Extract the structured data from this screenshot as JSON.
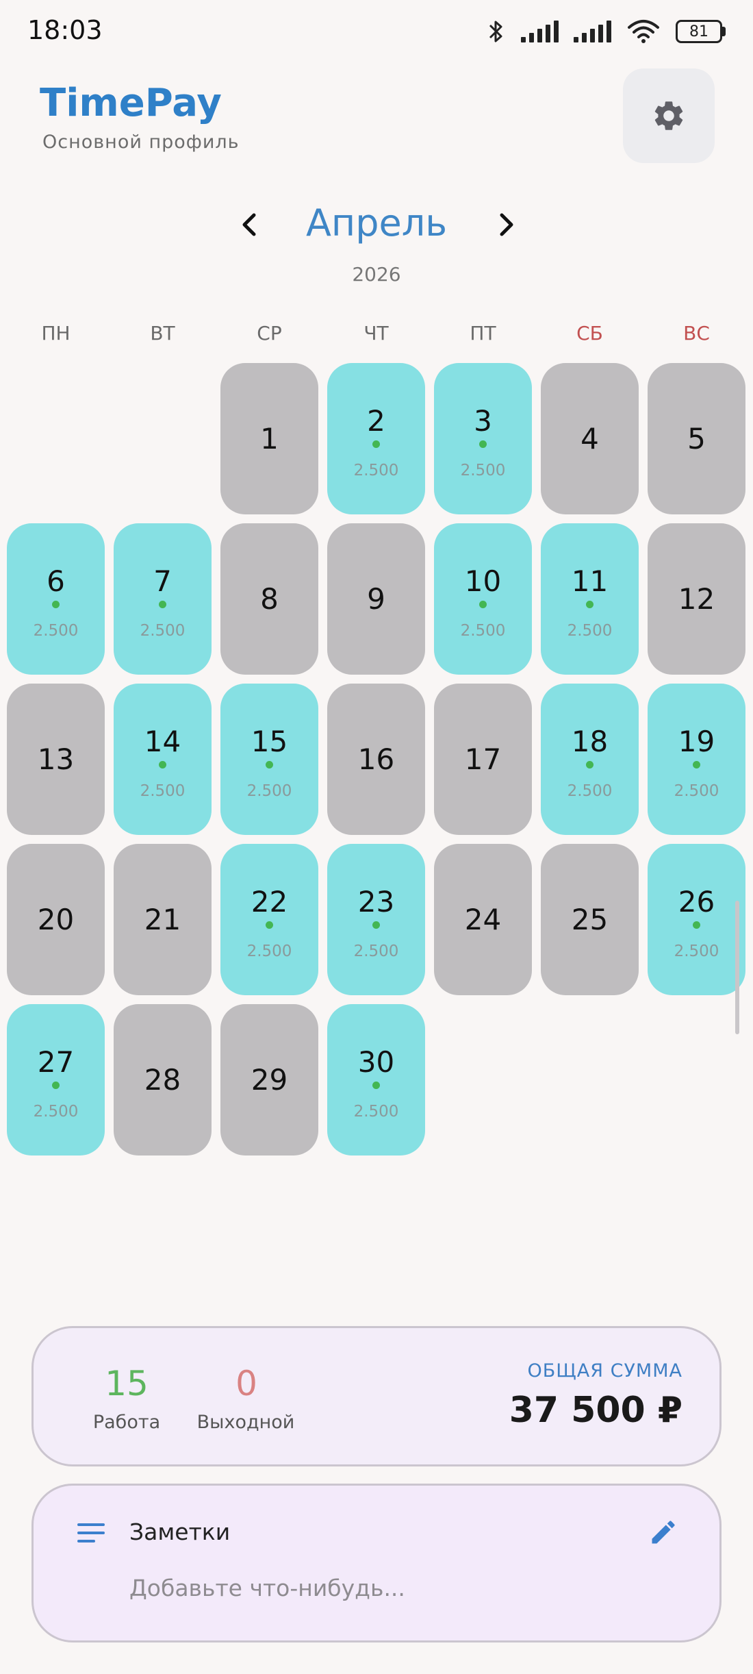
{
  "status_bar": {
    "time": "18:03",
    "battery": "81",
    "icons": [
      "bluetooth-icon",
      "signal-icon",
      "signal-icon",
      "wifi-icon",
      "battery-icon"
    ]
  },
  "header": {
    "title": "TimePay",
    "subtitle": "Основной профиль",
    "settings_icon": "gear-icon"
  },
  "calendar": {
    "month": "Апрель",
    "year": "2026",
    "prev_icon": "chevron-left-icon",
    "next_icon": "chevron-right-icon",
    "weekdays": [
      {
        "label": "ПН",
        "weekend": false
      },
      {
        "label": "ВТ",
        "weekend": false
      },
      {
        "label": "СР",
        "weekend": false
      },
      {
        "label": "ЧТ",
        "weekend": false
      },
      {
        "label": "ПТ",
        "weekend": false
      },
      {
        "label": "СБ",
        "weekend": true
      },
      {
        "label": "ВС",
        "weekend": true
      }
    ],
    "first_weekday_index": 2,
    "days": [
      {
        "day": "1",
        "status": "off"
      },
      {
        "day": "2",
        "status": "work",
        "amount": "2.500"
      },
      {
        "day": "3",
        "status": "work",
        "amount": "2.500"
      },
      {
        "day": "4",
        "status": "off"
      },
      {
        "day": "5",
        "status": "off"
      },
      {
        "day": "6",
        "status": "work",
        "amount": "2.500"
      },
      {
        "day": "7",
        "status": "work",
        "amount": "2.500"
      },
      {
        "day": "8",
        "status": "off"
      },
      {
        "day": "9",
        "status": "off"
      },
      {
        "day": "10",
        "status": "work",
        "amount": "2.500"
      },
      {
        "day": "11",
        "status": "work",
        "amount": "2.500"
      },
      {
        "day": "12",
        "status": "off"
      },
      {
        "day": "13",
        "status": "off"
      },
      {
        "day": "14",
        "status": "work",
        "amount": "2.500"
      },
      {
        "day": "15",
        "status": "work",
        "amount": "2.500"
      },
      {
        "day": "16",
        "status": "off"
      },
      {
        "day": "17",
        "status": "off"
      },
      {
        "day": "18",
        "status": "work",
        "amount": "2.500"
      },
      {
        "day": "19",
        "status": "work",
        "amount": "2.500"
      },
      {
        "day": "20",
        "status": "off"
      },
      {
        "day": "21",
        "status": "off"
      },
      {
        "day": "22",
        "status": "work",
        "amount": "2.500"
      },
      {
        "day": "23",
        "status": "work",
        "amount": "2.500"
      },
      {
        "day": "24",
        "status": "off"
      },
      {
        "day": "25",
        "status": "off"
      },
      {
        "day": "26",
        "status": "work",
        "amount": "2.500"
      },
      {
        "day": "27",
        "status": "work",
        "amount": "2.500"
      },
      {
        "day": "28",
        "status": "off"
      },
      {
        "day": "29",
        "status": "off"
      },
      {
        "day": "30",
        "status": "work",
        "amount": "2.500"
      }
    ]
  },
  "summary": {
    "work_count": "15",
    "work_label": "Работа",
    "off_count": "0",
    "off_label": "Выходной",
    "total_label": "ОБЩАЯ СУММА",
    "total_value": "37 500 ₽"
  },
  "notes": {
    "title": "Заметки",
    "placeholder": "Добавьте что-нибудь...",
    "icon": "notes-icon",
    "edit_icon": "pencil-icon"
  },
  "colors": {
    "accent": "#2f80c8",
    "work_day": "#86e0e3",
    "off_day": "#bfbdbf",
    "work_dot": "#43b653",
    "weekend_text": "#c25050",
    "work_count": "#5db55e",
    "off_count": "#d98282"
  }
}
